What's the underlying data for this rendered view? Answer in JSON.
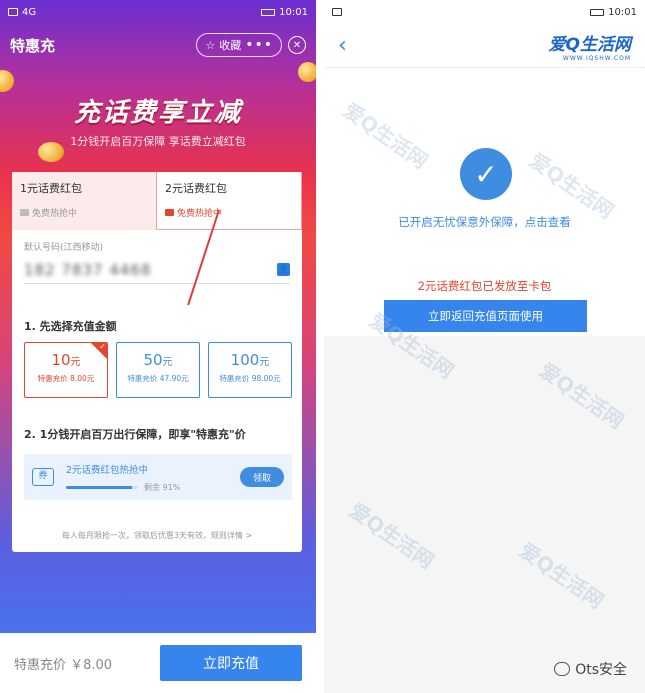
{
  "left": {
    "statusbar": {
      "time": "10:01",
      "signal": "4G"
    },
    "header": {
      "title": "特惠充",
      "fav_label": "收藏",
      "more": "•••",
      "close": "✕"
    },
    "banner": {
      "headline": "充话费享立减",
      "subline": "1分钱开启百万保障  享话费立减红包"
    },
    "tabs": [
      {
        "title": "1元话费红包",
        "sub": "免费热抢中"
      },
      {
        "title": "2元话费红包",
        "sub": "免费热抢中"
      }
    ],
    "phone": {
      "label": "默认号码(江西移动)",
      "number": "182 7837 4468"
    },
    "step1": "1. 先选择充值金额",
    "amounts": [
      {
        "value": "10",
        "unit": "元",
        "price": "特惠充价 8.00元"
      },
      {
        "value": "50",
        "unit": "元",
        "price": "特惠充价 47.90元"
      },
      {
        "value": "100",
        "unit": "元",
        "price": "特惠充价 98.00元"
      }
    ],
    "step2": "2. 1分钱开启百万出行保障，即享\"特惠充\"价",
    "promo": {
      "title": "2元话费红包热抢中",
      "remain": "剩余 91%",
      "progress": 0.91,
      "button": "领取"
    },
    "fineprint": "每人每月限抢一次，领取后优惠3天有效，规则详情 >",
    "bottom": {
      "price": "特惠充价 ￥8.00",
      "pay_button": "立即充值"
    }
  },
  "right": {
    "statusbar": {
      "time": "10:01"
    },
    "back": "‹",
    "logo": {
      "title": "爱Q生活网",
      "sub": "WWW.IQSHW.COM"
    },
    "success_message": "已开启无忧保意外保障，点击查看",
    "redpacket_message": "2元话费红包已发放至卡包",
    "return_button": "立即返回充值页面使用",
    "watermark": "爱Q生活网",
    "credit": "Ots安全"
  },
  "colors": {
    "accent_blue": "#3585ec",
    "accent_red": "#e4452e"
  }
}
